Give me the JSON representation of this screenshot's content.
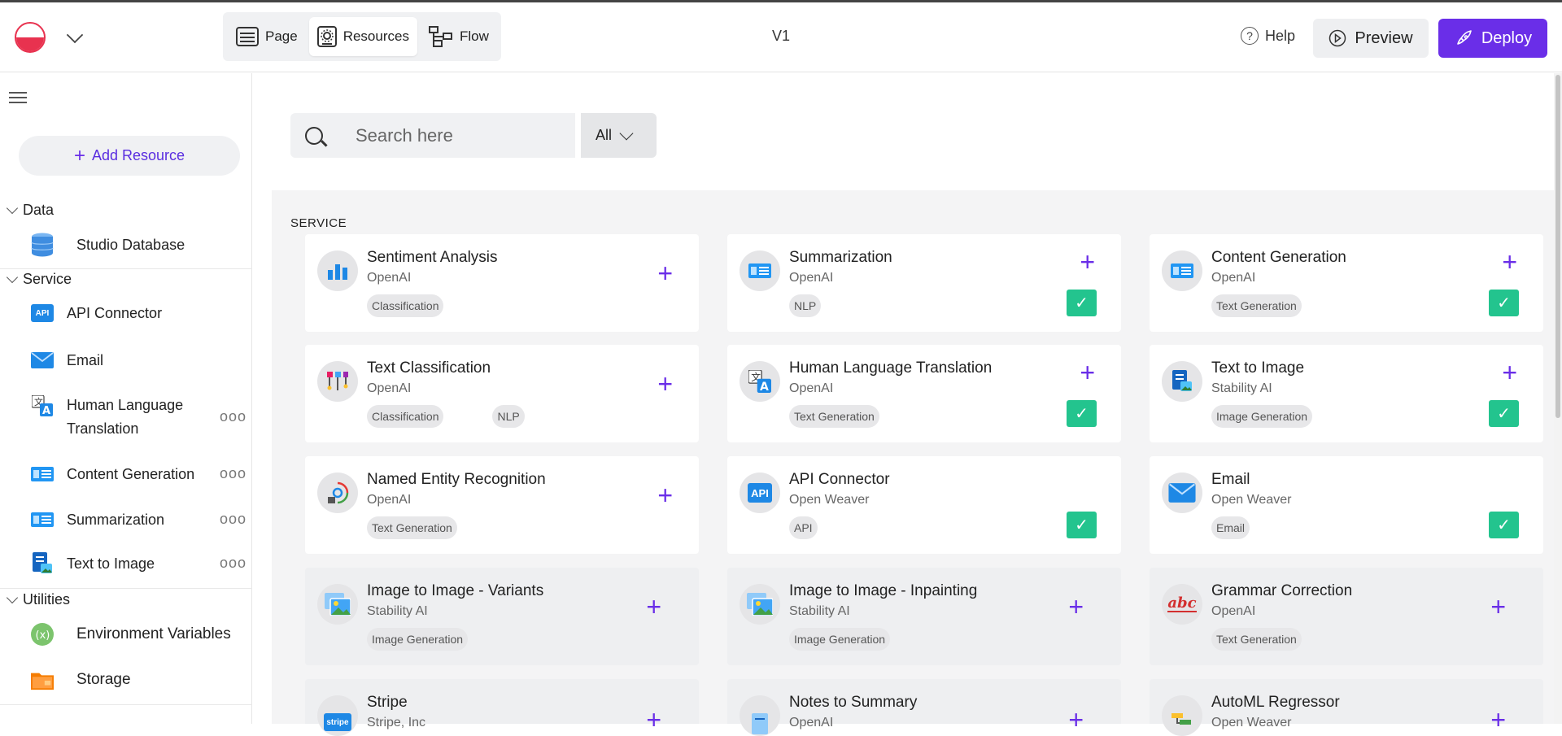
{
  "topbar": {
    "tabs": [
      {
        "label": "Page",
        "icon": "page-icon"
      },
      {
        "label": "Resources",
        "icon": "gear-icon"
      },
      {
        "label": "Flow",
        "icon": "flow-icon"
      }
    ],
    "active_tab": "Resources",
    "version": "V1",
    "help_label": "Help",
    "preview_label": "Preview",
    "deploy_label": "Deploy",
    "deploy_color": "#6a2ee8"
  },
  "sidebar": {
    "add_resource_label": "Add Resource",
    "groups": [
      {
        "label": "Data",
        "items": [
          {
            "label": "Studio Database",
            "icon": "database-icon"
          }
        ]
      },
      {
        "label": "Service",
        "items": [
          {
            "label": "API Connector",
            "icon": "api-icon"
          },
          {
            "label": "Email",
            "icon": "email-icon"
          },
          {
            "label": "Human Language Translation",
            "label_lines": [
              "Human Language",
              "Translation"
            ],
            "icon": "translation-icon",
            "more": "ooo"
          },
          {
            "label": "Content Generation",
            "icon": "content-generation-icon",
            "more": "ooo"
          },
          {
            "label": "Summarization",
            "icon": "summarization-icon",
            "more": "ooo"
          },
          {
            "label": "Text to Image",
            "icon": "text-to-image-icon",
            "more": "ooo"
          }
        ]
      },
      {
        "label": "Utilities",
        "items": [
          {
            "label": "Environment Variables",
            "icon": "environment-variables-icon"
          },
          {
            "label": "Storage",
            "icon": "storage-icon"
          }
        ]
      }
    ]
  },
  "search": {
    "placeholder": "Search here",
    "filter_value": "All"
  },
  "section_label": "SERVICE",
  "cards": [
    {
      "title": "Sentiment Analysis",
      "provider": "OpenAI",
      "tags": [
        "Classification"
      ],
      "added": false
    },
    {
      "title": "Summarization",
      "provider": "OpenAI",
      "tags": [
        "NLP"
      ],
      "added": true
    },
    {
      "title": "Content Generation",
      "provider": "OpenAI",
      "tags": [
        "Text Generation"
      ],
      "added": true
    },
    {
      "title": "Text Classification",
      "provider": "OpenAI",
      "tags": [
        "Classification",
        "NLP"
      ],
      "added": false
    },
    {
      "title": "Human Language Translation",
      "provider": "OpenAI",
      "tags": [
        "Text Generation"
      ],
      "added": true
    },
    {
      "title": "Text to Image",
      "provider": "Stability AI",
      "tags": [
        "Image Generation"
      ],
      "added": true
    },
    {
      "title": "Named Entity Recognition",
      "provider": "OpenAI",
      "tags": [
        "Text Generation"
      ],
      "added": false
    },
    {
      "title": "API Connector",
      "provider": "Open Weaver",
      "tags": [
        "API"
      ],
      "added": true
    },
    {
      "title": "Email",
      "provider": "Open Weaver",
      "tags": [
        "Email"
      ],
      "added": true
    },
    {
      "title": "Image to Image - Variants",
      "provider": "Stability AI",
      "tags": [
        "Image Generation"
      ],
      "added": false
    },
    {
      "title": "Image to Image - Inpainting",
      "provider": "Stability AI",
      "tags": [
        "Image Generation"
      ],
      "added": false
    },
    {
      "title": "Grammar Correction",
      "provider": "OpenAI",
      "tags": [
        "Text Generation"
      ],
      "added": false
    },
    {
      "title": "Stripe",
      "provider": "Stripe, Inc",
      "tags": [],
      "added": false
    },
    {
      "title": "Notes to Summary",
      "provider": "OpenAI",
      "tags": [],
      "added": false
    },
    {
      "title": "AutoML Regressor",
      "provider": "Open Weaver",
      "tags": [],
      "added": false
    }
  ],
  "icons": {
    "api_badge": "API",
    "abc_badge": "abc",
    "stripe_badge": "stripe",
    "check_glyph": "✓",
    "plus_glyph": "+"
  }
}
